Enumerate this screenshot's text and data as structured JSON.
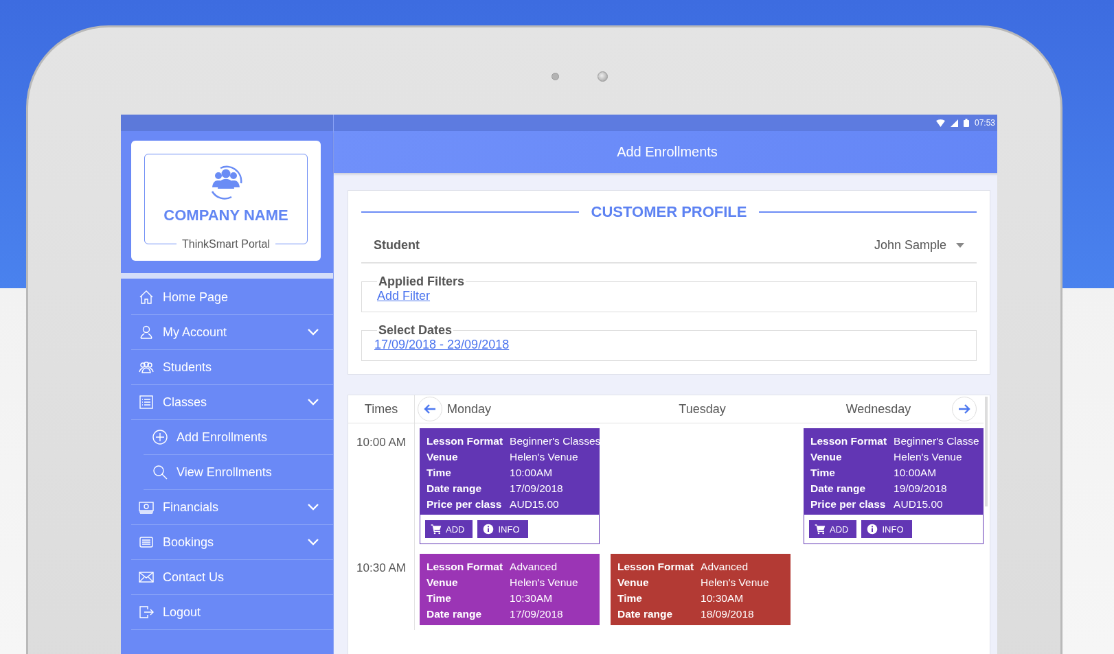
{
  "status_bar": {
    "time": "07:53"
  },
  "sidebar": {
    "company": "COMPANY NAME",
    "portal": "ThinkSmart Portal",
    "items": [
      {
        "label": "Home Page",
        "has_submenu": false
      },
      {
        "label": "My Account",
        "has_submenu": true
      },
      {
        "label": "Students",
        "has_submenu": false
      },
      {
        "label": "Classes",
        "has_submenu": true,
        "children": [
          {
            "label": "Add Enrollments"
          },
          {
            "label": "View Enrollments"
          }
        ]
      },
      {
        "label": "Financials",
        "has_submenu": true
      },
      {
        "label": "Bookings",
        "has_submenu": true
      },
      {
        "label": "Contact Us",
        "has_submenu": false
      },
      {
        "label": "Logout",
        "has_submenu": false
      }
    ]
  },
  "header": {
    "title": "Add Enrollments"
  },
  "profile": {
    "title": "CUSTOMER PROFILE",
    "student_label": "Student",
    "student_value": "John Sample",
    "filters": {
      "legend": "Applied Filters",
      "link": "Add Filter"
    },
    "dates": {
      "legend": "Select Dates",
      "link": "17/09/2018 - 23/09/2018"
    }
  },
  "calendar": {
    "times_header": "Times",
    "days": [
      "Monday",
      "Tuesday",
      "Wednesday"
    ],
    "slots": [
      {
        "time": "10:00 AM",
        "cells": [
          {
            "kind": "event",
            "color": "#6236b4",
            "fields": [
              {
                "label": "Lesson Format",
                "value": "Beginner's Classes"
              },
              {
                "label": "Venue",
                "value": "Helen's Venue"
              },
              {
                "label": "Time",
                "value": "10:00AM"
              },
              {
                "label": "Date range",
                "value": "17/09/2018"
              },
              {
                "label": "Price per class",
                "value": "AUD15.00"
              }
            ],
            "actions": [
              {
                "kind": "add",
                "label": "ADD"
              },
              {
                "kind": "info",
                "label": "INFO"
              }
            ]
          },
          {
            "kind": "empty"
          },
          {
            "kind": "event",
            "color": "#6236b4",
            "fields": [
              {
                "label": "Lesson Format",
                "value": "Beginner's Classe"
              },
              {
                "label": "Venue",
                "value": "Helen's Venue"
              },
              {
                "label": "Time",
                "value": "10:00AM"
              },
              {
                "label": "Date range",
                "value": "19/09/2018"
              },
              {
                "label": "Price per class",
                "value": "AUD15.00"
              }
            ],
            "actions": [
              {
                "kind": "add",
                "label": "ADD"
              },
              {
                "kind": "info",
                "label": "INFO"
              }
            ]
          }
        ]
      },
      {
        "time": "10:30 AM",
        "cells": [
          {
            "kind": "event",
            "color": "#9b35b5",
            "fields": [
              {
                "label": "Lesson Format",
                "value": "Advanced"
              },
              {
                "label": "Venue",
                "value": "Helen's Venue"
              },
              {
                "label": "Time",
                "value": "10:30AM"
              },
              {
                "label": "Date range",
                "value": "17/09/2018"
              }
            ]
          },
          {
            "kind": "event",
            "color": "#b33a34",
            "fields": [
              {
                "label": "Lesson Format",
                "value": "Advanced"
              },
              {
                "label": "Venue",
                "value": "Helen's Venue"
              },
              {
                "label": "Time",
                "value": "10:30AM"
              },
              {
                "label": "Date range",
                "value": "18/09/2018"
              }
            ]
          },
          {
            "kind": "empty"
          }
        ]
      }
    ]
  }
}
